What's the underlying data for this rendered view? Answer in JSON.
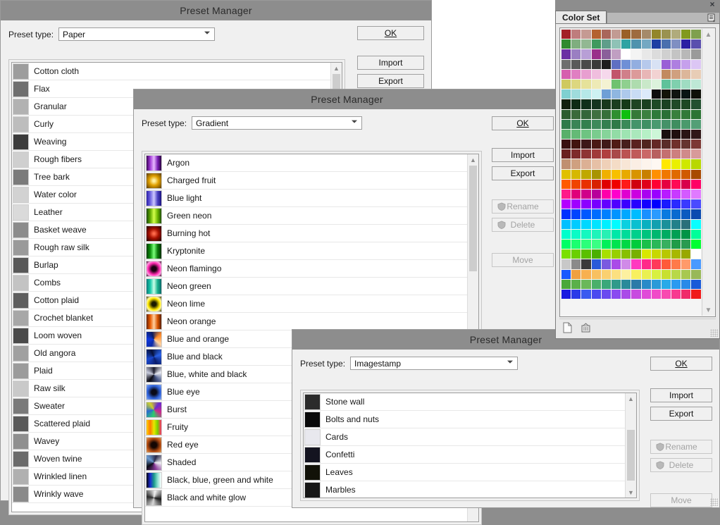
{
  "app": {
    "background_color": "#8d8d8d",
    "canvas_color": "#ffffff"
  },
  "common": {
    "title": "Preset Manager",
    "preset_type_label": "Preset type:",
    "buttons": {
      "ok": "OK",
      "import": "Import",
      "export": "Export",
      "rename": "Rename",
      "delete": "Delete",
      "move": "Move"
    }
  },
  "dialogs": [
    {
      "id": "paper",
      "title": "Preset Manager",
      "preset_type_label": "Preset type:",
      "preset_type_value": "Paper",
      "buttons": {
        "ok": "OK",
        "import": "Import",
        "export": "Export"
      },
      "items": [
        {
          "name": "Cotton cloth",
          "swatch": "#9d9d9d"
        },
        {
          "name": "Flax",
          "swatch": "#6f6f6f"
        },
        {
          "name": "Granular",
          "swatch": "#b2b2b2"
        },
        {
          "name": "Curly",
          "swatch": "#bdbdbd"
        },
        {
          "name": "Weaving",
          "swatch": "#3c3c3c"
        },
        {
          "name": "Rough fibers",
          "swatch": "#cfcfcf"
        },
        {
          "name": "Tree bark",
          "swatch": "#7b7b7b"
        },
        {
          "name": "Water color",
          "swatch": "#d2d2d2"
        },
        {
          "name": "Leather",
          "swatch": "#dadada"
        },
        {
          "name": "Basket weave",
          "swatch": "#8c8c8c"
        },
        {
          "name": "Rough raw silk",
          "swatch": "#9a9a9a"
        },
        {
          "name": "Burlap",
          "swatch": "#585858"
        },
        {
          "name": "Combs",
          "swatch": "#c3c3c3"
        },
        {
          "name": "Cotton plaid",
          "swatch": "#5e5e5e"
        },
        {
          "name": "Crochet blanket",
          "swatch": "#a7a7a7"
        },
        {
          "name": "Loom woven",
          "swatch": "#4a4a4a"
        },
        {
          "name": "Old angora",
          "swatch": "#a0a0a0"
        },
        {
          "name": "Plaid",
          "swatch": "#9b9b9b"
        },
        {
          "name": "Raw silk",
          "swatch": "#c9c9c9"
        },
        {
          "name": "Sweater",
          "swatch": "#7a7a7a"
        },
        {
          "name": "Scattered plaid",
          "swatch": "#5a5a5a"
        },
        {
          "name": "Wavey",
          "swatch": "#8f8f8f"
        },
        {
          "name": "Woven twine",
          "swatch": "#6b6b6b"
        },
        {
          "name": "Wrinkled linen",
          "swatch": "#b0b0b0"
        },
        {
          "name": "Wrinkly wave",
          "swatch": "#8a8a8a"
        }
      ]
    },
    {
      "id": "gradient",
      "title": "Preset Manager",
      "preset_type_label": "Preset type:",
      "preset_type_value": "Gradient",
      "buttons": {
        "ok": "OK",
        "import": "Import",
        "export": "Export",
        "rename": "Rename",
        "delete": "Delete",
        "move": "Move"
      },
      "items": [
        {
          "name": "Argon",
          "swatch": "linear-gradient(90deg,#3b0357,#a23cd6,#e7b8ff,#7b1fb5,#2b0240)"
        },
        {
          "name": "Charged fruit",
          "swatch": "radial-gradient(circle at 50% 50%,#fff0a0 10%,#e0a000 45%,#5a3b00 100%)"
        },
        {
          "name": "Blue light",
          "swatch": "linear-gradient(90deg,#2b1fa8,#6d63e0,#cdc8ff,#4a3fc2,#1b1480)"
        },
        {
          "name": "Green neon",
          "swatch": "linear-gradient(90deg,#1b4a00,#5ea800,#d4ff4a,#6bb400,#1f5200)"
        },
        {
          "name": "Burning hot",
          "swatch": "radial-gradient(circle at 50% 50%,#ff6a4a 8%,#a81000 45%,#1a0000 100%)"
        },
        {
          "name": "Kryptonite",
          "swatch": "linear-gradient(90deg,#063d06,#0a8f0a,#7bff7b,#0a7a0a,#043004)"
        },
        {
          "name": "Neon flamingo",
          "swatch": "radial-gradient(circle at 50% 50%,#1a0010 22%,#ff2bb0 55%,#ff9fe0 75%,#3a0024 100%)"
        },
        {
          "name": "Neon green",
          "swatch": "linear-gradient(90deg,#0b7a7a,#15c9a8,#c9ffe8,#18b08c,#0a6a6a)"
        },
        {
          "name": "Neon lime",
          "swatch": "radial-gradient(circle at 50% 50%,#1a1a00 20%,#ffe800 55%,#fff8a0 72%,#3a3600 100%)"
        },
        {
          "name": "Neon orange",
          "swatch": "linear-gradient(90deg,#6a2400,#e85a00,#ffd0a0,#d85400,#5a1f00)"
        },
        {
          "name": "Blue and orange",
          "swatch": "conic-gradient(from 200deg,#0a2aa8,#123adf,#0a1a60,#ff8a2a,#ffd2a0,#0a2aa8)"
        },
        {
          "name": "Blue and black",
          "swatch": "conic-gradient(from 160deg,#0a1c6a,#1b4ad0,#061038,#2a62e8,#0a1c6a)"
        },
        {
          "name": "Blue, white and black",
          "swatch": "conic-gradient(from 0deg,#1a1a2a,#e8eaf2,#4a5a8a,#0a0a14,#c8ccdd,#1a1a2a)"
        },
        {
          "name": "Blue eye",
          "swatch": "radial-gradient(circle at 50% 50%,#0a0a18 24%,#2f62d8 60%,#86a8f0 100%)"
        },
        {
          "name": "Burst",
          "swatch": "conic-gradient(from 40deg,#6a2ad0,#d02a8a,#2ad06a,#2a6ad0,#d0d02a,#6a2ad0)"
        },
        {
          "name": "Fruity",
          "swatch": "linear-gradient(90deg,#ffd000,#ff7a00,#e8e800,#7ad000,#ff2a6a)"
        },
        {
          "name": "Red eye",
          "swatch": "radial-gradient(circle at 50% 50%,#140603 26%,#b04a12 62%,#e0a060 100%)"
        },
        {
          "name": "Shaded",
          "swatch": "conic-gradient(from 20deg,#2a2a4a,#f0f0f4,#8a3a9a,#0a0a14,#6a9ad0,#2a2a4a)"
        },
        {
          "name": "Black, blue, green and white",
          "swatch": "linear-gradient(90deg,#05050a,#1a2ad0,#1a9a8a,#8ae0d0,#ffffff)"
        },
        {
          "name": "Black and white glow",
          "swatch": "conic-gradient(from 10deg,#f2f2f2,#1a1a1a,#d8d8d8,#2a2a2a,#f2f2f2)"
        }
      ]
    },
    {
      "id": "imagestamp",
      "title": "Preset Manager",
      "preset_type_label": "Preset type:",
      "preset_type_value": "Imagestamp",
      "buttons": {
        "ok": "OK",
        "import": "Import",
        "export": "Export",
        "rename": "Rename",
        "delete": "Delete",
        "move": "Move"
      },
      "items": [
        {
          "name": "Stone wall",
          "swatch": "#2b2b2b"
        },
        {
          "name": "Bolts and nuts",
          "swatch": "#0a0a0a"
        },
        {
          "name": "Cards",
          "swatch": "#e8e8ee"
        },
        {
          "name": "Confetti",
          "swatch": "#141420"
        },
        {
          "name": "Leaves",
          "swatch": "#121208"
        },
        {
          "name": "Marbles",
          "swatch": "#161616"
        }
      ]
    }
  ],
  "color_set": {
    "tab_label": "Color Set",
    "close_label": "×",
    "menu_icon": "panel-menu-icon",
    "new_icon": "new-swatch-icon",
    "delete_icon": "delete-swatch-icon",
    "columns": 14,
    "swatches": [
      "#a32027",
      "#bf7d7d",
      "#c59a93",
      "#b4622f",
      "#a9665b",
      "#c29b93",
      "#9a6027",
      "#9e6b3f",
      "#a58a6a",
      "#93862a",
      "#9a9250",
      "#b0ab7c",
      "#82991f",
      "#7fa04e",
      "#2f8a2f",
      "#7fae7f",
      "#92b892",
      "#3f9a5e",
      "#5f9e8a",
      "#8fc2b6",
      "#2fa3a3",
      "#4f93ad",
      "#74a8c2",
      "#1f3fa3",
      "#4a6fae",
      "#7f8fc2",
      "#2b1fa3",
      "#5a4fae",
      "#6b2fa3",
      "#9a7fc2",
      "#b89fd6",
      "#9a2f8a",
      "#8a5f9a",
      "#c09fc2",
      "#ffffff",
      "#f4f4f4",
      "#e8e8e8",
      "#dcdcdc",
      "#d0d0d0",
      "#c4c4c4",
      "#b8b8b8",
      "#9a9a9a",
      "#6e6e6e",
      "#5a5a5a",
      "#4a4a4a",
      "#3a3a3a",
      "#1e1e1e",
      "#5f6fc2",
      "#6f8fd6",
      "#92aee0",
      "#b6c9ec",
      "#d8e2f4",
      "#9a5fd6",
      "#ae7fe0",
      "#c6a0ec",
      "#dcc6f4",
      "#d65fae",
      "#e07fc2",
      "#e89fd0",
      "#f0bede",
      "#f6d8ec",
      "#c2556b",
      "#d07f8a",
      "#dc9a9a",
      "#e8b6b6",
      "#f2d2d2",
      "#c2895f",
      "#d0a07f",
      "#dcb69a",
      "#e8cdb6",
      "#cfc95f",
      "#ddd77f",
      "#e6e29a",
      "#eeeab6",
      "#f4f2d2",
      "#6fc26f",
      "#8fd08f",
      "#aedcae",
      "#c9e8c9",
      "#dcf2dc",
      "#5fc29a",
      "#7fd0ae",
      "#9fdcc2",
      "#bee8d6",
      "#7fd0d0",
      "#9fdcdc",
      "#b6e8e8",
      "#cdf2f2",
      "#6f9fd6",
      "#8fb6e0",
      "#aec9ec",
      "#c9dcf4",
      "#dceafa",
      "#0d0d0d",
      "#141408",
      "#101410",
      "#0a1414",
      "#0e1008",
      "#12200f",
      "#0f2a14",
      "#0f2f1a",
      "#14341f",
      "#18381c",
      "#1c3e20",
      "#153a18",
      "#1e4422",
      "#1a4020",
      "#1e4a26",
      "#1b4222",
      "#204a28",
      "#1d4824",
      "#225030",
      "#2c5c2e",
      "#3a6a3a",
      "#33663a",
      "#3f7040",
      "#36703a",
      "#2f8f2f",
      "#0fbf0f",
      "#357a38",
      "#3c8040",
      "#2f7a3a",
      "#2a7036",
      "#38803c",
      "#317a38",
      "#2c7434",
      "#2f7a4a",
      "#3a8456",
      "#33804e",
      "#3d8a5a",
      "#347f50",
      "#2f7a48",
      "#3a8a58",
      "#44946a",
      "#3f9064",
      "#4a9a70",
      "#449268",
      "#3f8e60",
      "#4a9a6c",
      "#549f76",
      "#58b06a",
      "#64ba76",
      "#6ec482",
      "#7acc8e",
      "#86d49a",
      "#92dca6",
      "#9ee4b2",
      "#aae8bc",
      "#b6f0c6",
      "#cdf6d8",
      "#1a0f0f",
      "#200f0f",
      "#2a1414",
      "#301818",
      "#3a1010",
      "#42140f",
      "#3c1818",
      "#4a1a14",
      "#401a18",
      "#501c16",
      "#471f1c",
      "#5a2220",
      "#50241e",
      "#642826",
      "#5a2c28",
      "#70302c",
      "#663430",
      "#7c3834",
      "#6a2020",
      "#7e2a2a",
      "#8e3434",
      "#a03a3a",
      "#b04040",
      "#a94a4a",
      "#bb5252",
      "#c05a5a",
      "#ca6868",
      "#b86060",
      "#c47070",
      "#cd7f7f",
      "#d08a8a",
      "#d89a9a",
      "#c09070",
      "#cfa080",
      "#dcb094",
      "#e6c0a6",
      "#efd0b8",
      "#f4dcc6",
      "#f8e6d6",
      "#fbeee4",
      "#fdf4ec",
      "#fef8f2",
      "#ffe800",
      "#eaf000",
      "#cfe800",
      "#b8d800",
      "#e0c000",
      "#d6b800",
      "#c0a800",
      "#a89400",
      "#f0b000",
      "#f8c000",
      "#e8aa00",
      "#d89400",
      "#c88000",
      "#ff9000",
      "#f07800",
      "#e06a00",
      "#d05a00",
      "#a84a00",
      "#ff5a00",
      "#f04400",
      "#e83000",
      "#d82000",
      "#e00000",
      "#f00000",
      "#ff1a1a",
      "#d00010",
      "#e0001a",
      "#ff0033",
      "#e60040",
      "#ff0a55",
      "#d8004a",
      "#ff0066",
      "#ff1a8a",
      "#e0007a",
      "#d0008a",
      "#b8009a",
      "#ff00aa",
      "#ff00cc",
      "#e000d0",
      "#cc00e0",
      "#aa00f0",
      "#9a00ff",
      "#b81aff",
      "#c83aff",
      "#d45aff",
      "#e07aff",
      "#b400ff",
      "#a000ff",
      "#8c00ff",
      "#7800ff",
      "#6400ff",
      "#5000ff",
      "#3c00ff",
      "#2800ff",
      "#1400ff",
      "#0000ff",
      "#1a1aff",
      "#2a2aff",
      "#3a3aff",
      "#4a4aff",
      "#0030ff",
      "#0044ff",
      "#0058ff",
      "#006cff",
      "#0080ff",
      "#0094ff",
      "#00a8ff",
      "#00bcff",
      "#1a90ff",
      "#2a9aff",
      "#0a7ae0",
      "#0a6ad0",
      "#0a5ac0",
      "#0a4ab0",
      "#00c0ff",
      "#00ccff",
      "#00d8ff",
      "#00e4ff",
      "#00f0ff",
      "#00fcff",
      "#0ad0e0",
      "#0ac0d0",
      "#0ab0c0",
      "#12a0b0",
      "#1a909a",
      "#22808a",
      "#2a707a",
      "#0affff",
      "#00ffcc",
      "#0afcc6",
      "#14f8c0",
      "#1ef4ba",
      "#28f0b4",
      "#00e8a8",
      "#00dc9a",
      "#00d08c",
      "#00c47e",
      "#00b870",
      "#00ac62",
      "#00a054",
      "#009446",
      "#00ff9a",
      "#00ff66",
      "#1aff70",
      "#2aff7a",
      "#3aff84",
      "#00f05a",
      "#00e450",
      "#00d846",
      "#00cc3c",
      "#1ac04a",
      "#2ab858",
      "#38b060",
      "#1f9c48",
      "#2a9a50",
      "#00ff33",
      "#7ae000",
      "#6ad000",
      "#5ac000",
      "#4ab000",
      "#a8e000",
      "#98d000",
      "#88c000",
      "#78b000",
      "#d8e800",
      "#c8d800",
      "#b8c800",
      "#a8b800",
      "#98a800",
      "#ffffff",
      "#c8c8c8",
      "#8a8a8a",
      "#3a3a3a",
      "#2a5ad8",
      "#7a5ae0",
      "#aa4ae8",
      "#d08ae8",
      "#ff3ac0",
      "#ff2a8a",
      "#ff3a5a",
      "#ff5a3a",
      "#ff7a4a",
      "#ff9a6a",
      "#4a9aff",
      "#1a5aff",
      "#f0a040",
      "#f8b050",
      "#f8c060",
      "#fad070",
      "#fce080",
      "#fdf0a0",
      "#f8f060",
      "#eaf050",
      "#d8f040",
      "#c8e030",
      "#b8d848",
      "#a8c850",
      "#98b858",
      "#4aa83a",
      "#5ab04a",
      "#6ab85a",
      "#4ab06a",
      "#3aa87a",
      "#2f9a8a",
      "#2a8a9a",
      "#2a7aa8",
      "#2a8ac8",
      "#2a9ad8",
      "#2aaae8",
      "#2a9af0",
      "#2a8ae8",
      "#1a5ad8",
      "#1a1ae0",
      "#2a3ae8",
      "#3a5af0",
      "#4a4af0",
      "#6a4af0",
      "#8a4af0",
      "#aa4ae8",
      "#c84ae0",
      "#e04ad8",
      "#f04ac8",
      "#f84ab0",
      "#f83a90",
      "#f02a6a",
      "#f01a1a"
    ]
  }
}
